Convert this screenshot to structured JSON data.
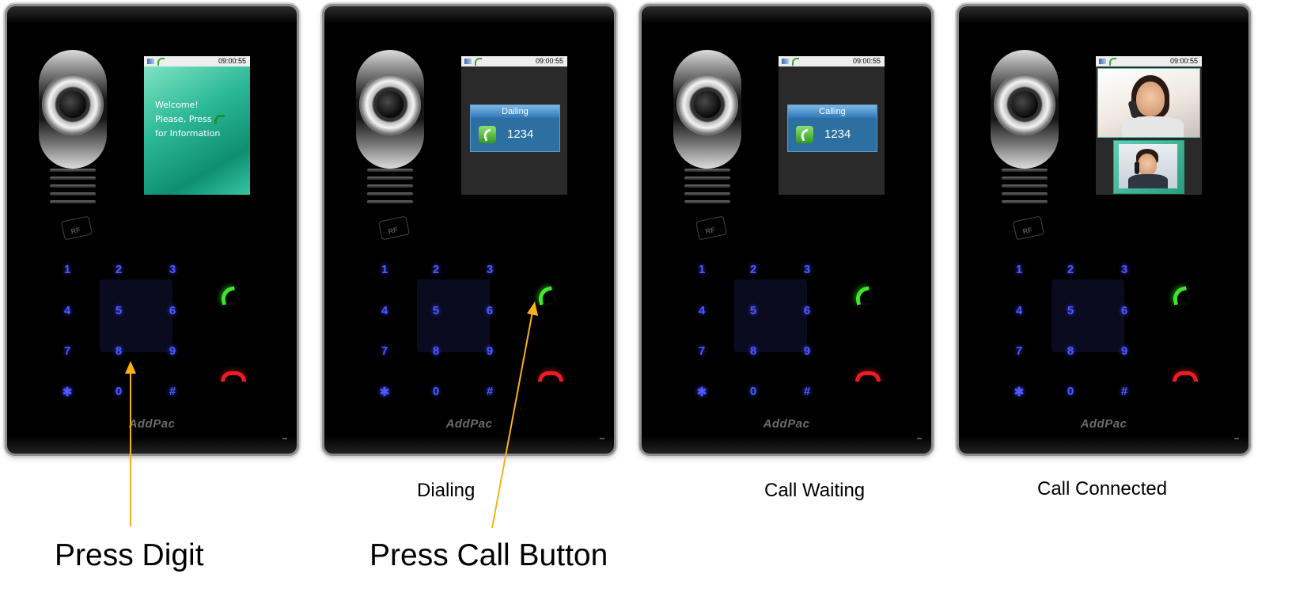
{
  "devices": [
    {
      "screen": {
        "clock": "09:00:55",
        "welcome_lines": [
          "Welcome!",
          "Please, Press",
          "for Information"
        ]
      }
    },
    {
      "screen": {
        "clock": "09:00:55",
        "box_title": "Dailing",
        "number": "1234"
      }
    },
    {
      "screen": {
        "clock": "09:00:55",
        "box_title": "Calling",
        "number": "1234"
      }
    },
    {
      "screen": {
        "clock": "09:00:55"
      }
    }
  ],
  "keypad": {
    "keys": [
      "1",
      "2",
      "3",
      "4",
      "5",
      "6",
      "7",
      "8",
      "9",
      "✱",
      "0",
      "#"
    ]
  },
  "rf_label": "RF",
  "brand": "AddPac",
  "captions": {
    "dialing": "Dialing",
    "call_waiting": "Call Waiting",
    "call_connected": "Call Connected",
    "press_digit": "Press Digit",
    "press_call_button": "Press Call Button"
  },
  "colors": {
    "keypad_digit": "#4e58ff",
    "call_button": "#3de72a",
    "hangup_button": "#ef1b24",
    "arrow": "#f5b316",
    "welcome_screen": "#2bb896",
    "dial_box": "#2d6fa0"
  }
}
